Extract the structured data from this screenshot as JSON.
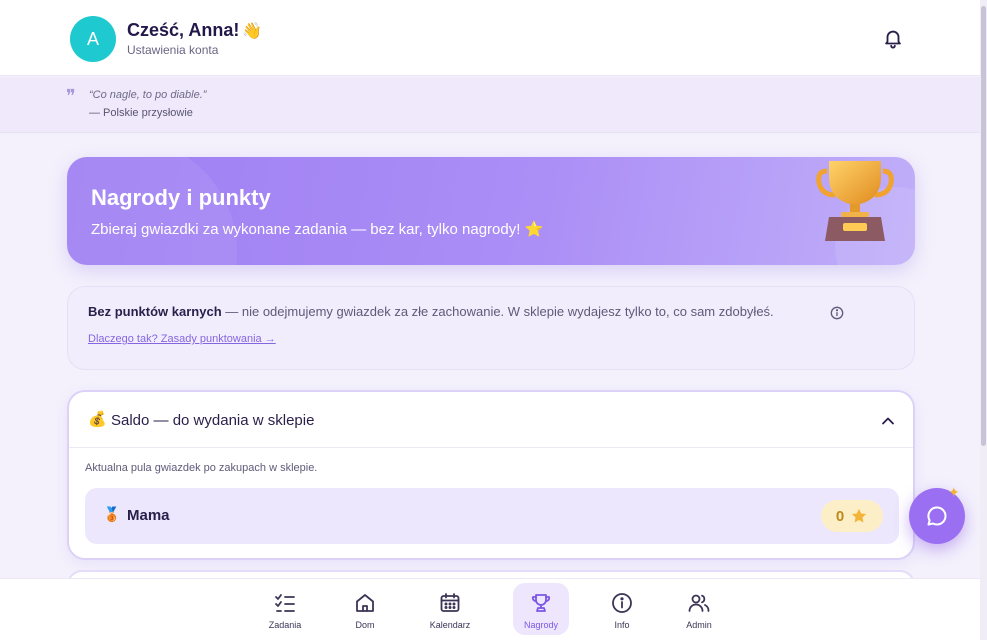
{
  "header": {
    "avatar_initial": "A",
    "greeting": "Cześć, Anna!",
    "greeting_emoji": "👋",
    "account_link": "Ustawienia konta"
  },
  "quote": {
    "text": "“Co nagle, to po diable.”",
    "source": "— Polskie przysłowie"
  },
  "hero": {
    "title": "Nagrody i punkty",
    "subtitle": "Zbieraj gwiazdki za wykonane zadania — bez kar, tylko nagrody! ⭐"
  },
  "info": {
    "bold": "Bez punktów karnych",
    "text": " — nie odejmujemy gwiazdek za złe zachowanie. W sklepie wydajesz tylko to, co sam zdobyłeś.",
    "link": "Dlaczego tak? Zasady punktowania →"
  },
  "saldo": {
    "icon": "💰",
    "title": "Saldo — do wydania w sklepie",
    "description": "Aktualna pula gwiazdek po zakupach w sklepie.",
    "members": [
      {
        "medal": "🥉",
        "name": "Mama",
        "stars": "0"
      }
    ]
  },
  "nav": {
    "items": [
      {
        "label": "Zadania",
        "icon": "checklist-icon",
        "active": false
      },
      {
        "label": "Dom",
        "icon": "home-icon",
        "active": false
      },
      {
        "label": "Kalendarz",
        "icon": "calendar-icon",
        "active": false
      },
      {
        "label": "Nagrody",
        "icon": "trophy-icon",
        "active": true
      },
      {
        "label": "Info",
        "icon": "info-icon",
        "active": false
      },
      {
        "label": "Admin",
        "icon": "users-icon",
        "active": false
      }
    ]
  },
  "colors": {
    "accent": "#9b6ff2",
    "avatar": "#1ec9cf",
    "star": "#f4b43a"
  }
}
